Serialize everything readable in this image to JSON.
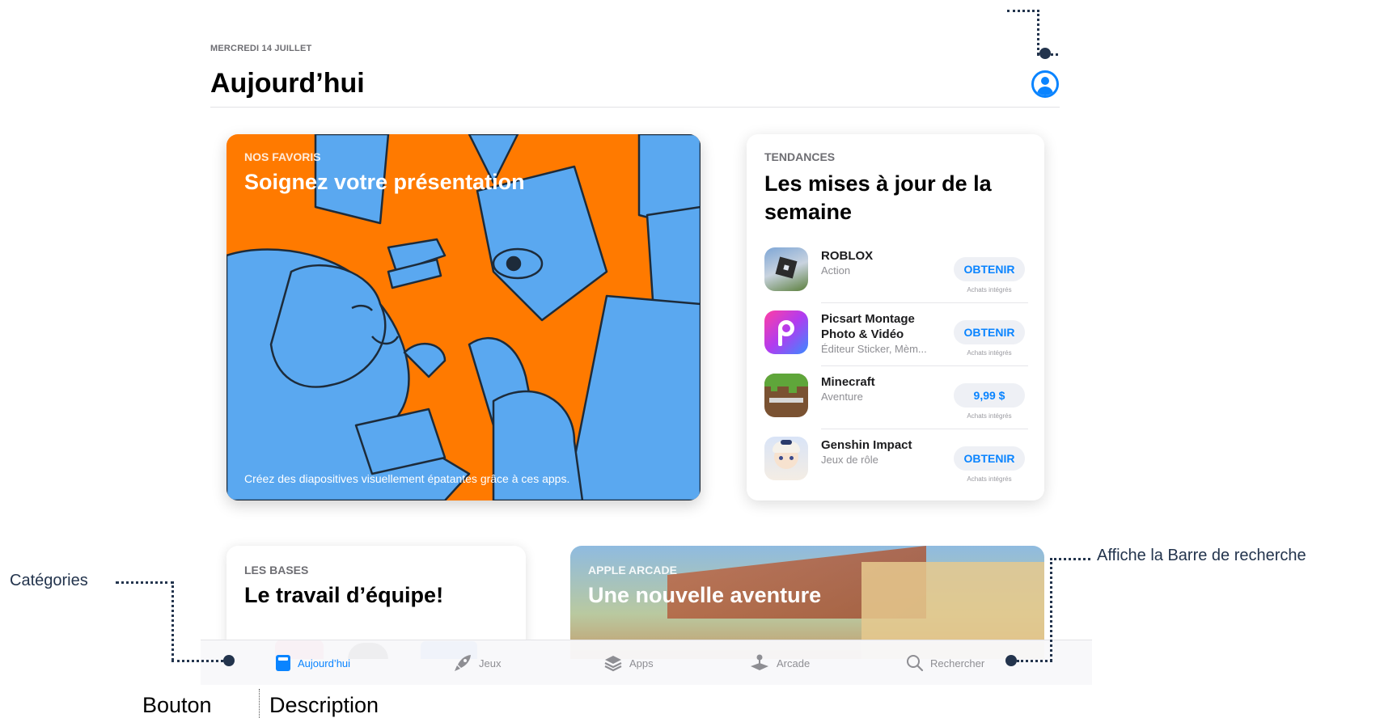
{
  "header": {
    "date": "MERCREDI 14 JUILLET",
    "title": "Aujourd’hui"
  },
  "featured": {
    "eyebrow": "NOS FAVORIS",
    "headline": "Soignez votre présentation",
    "caption": "Créez des diapositives visuellement épatantes grâce à ces apps.",
    "colors": {
      "background": "#ff7a00",
      "art": "#5aa8f0"
    }
  },
  "trending": {
    "eyebrow": "TENDANCES",
    "headline": "Les mises à jour de la semaine",
    "in_app_note": "Achats intégrés",
    "apps": [
      {
        "name": "ROBLOX",
        "subtitle": "Action",
        "button": "OBTENIR",
        "icon": "roblox-icon"
      },
      {
        "name": "Picsart Montage Photo & Vidéo",
        "subtitle": "Éditeur Sticker, Mèm...",
        "button": "OBTENIR",
        "icon": "picsart-icon"
      },
      {
        "name": "Minecraft",
        "subtitle": "Aventure",
        "button": "9,99 $",
        "icon": "minecraft-icon"
      },
      {
        "name": "Genshin Impact",
        "subtitle": "Jeux de rôle",
        "button": "OBTENIR",
        "icon": "genshin-icon"
      }
    ]
  },
  "basics": {
    "eyebrow": "LES BASES",
    "headline": "Le travail d’équipe!"
  },
  "arcade_card": {
    "eyebrow": "APPLE ARCADE",
    "headline": "Une nouvelle aventure"
  },
  "tabbar": {
    "tabs": [
      {
        "label": "Aujourd’hui",
        "icon": "today-icon",
        "active": true
      },
      {
        "label": "Jeux",
        "icon": "rocket-icon",
        "active": false
      },
      {
        "label": "Apps",
        "icon": "stack-icon",
        "active": false
      },
      {
        "label": "Arcade",
        "icon": "joystick-icon",
        "active": false
      },
      {
        "label": "Rechercher",
        "icon": "search-icon",
        "active": false
      }
    ]
  },
  "annotations": {
    "categories": "Catégories",
    "search_bar": "Affiche la Barre de recherche"
  },
  "table": {
    "col_button": "Bouton",
    "col_description": "Description"
  },
  "colors": {
    "accent": "#0a84ff",
    "annotation": "#23344d"
  }
}
